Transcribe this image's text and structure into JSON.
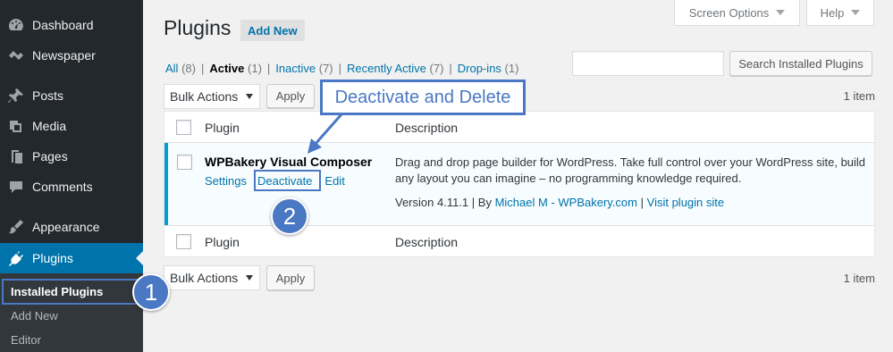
{
  "sidebar": {
    "items": [
      {
        "label": "Dashboard",
        "icon": "dashboard-icon"
      },
      {
        "label": "Newspaper",
        "icon": "newspaper-icon"
      },
      {
        "label": "Posts",
        "icon": "pin-icon"
      },
      {
        "label": "Media",
        "icon": "media-icon"
      },
      {
        "label": "Pages",
        "icon": "pages-icon"
      },
      {
        "label": "Comments",
        "icon": "comments-icon"
      },
      {
        "label": "Appearance",
        "icon": "brush-icon"
      },
      {
        "label": "Plugins",
        "icon": "plug-icon"
      }
    ],
    "submenu": [
      "Installed Plugins",
      "Add New",
      "Editor"
    ]
  },
  "header": {
    "title": "Plugins",
    "add_new": "Add New",
    "screen_options": "Screen Options",
    "help": "Help"
  },
  "filters": {
    "all": "All",
    "all_count": "(8)",
    "active": "Active",
    "active_count": "(1)",
    "inactive": "Inactive",
    "inactive_count": "(7)",
    "recent": "Recently Active",
    "recent_count": "(7)",
    "dropins": "Drop-ins",
    "dropins_count": "(1)",
    "separator": "|"
  },
  "search": {
    "button": "Search Installed Plugins",
    "value": ""
  },
  "bulk": {
    "select": "Bulk Actions",
    "apply": "Apply",
    "count": "1 item"
  },
  "table": {
    "col_plugin": "Plugin",
    "col_description": "Description",
    "plugin": {
      "name": "WPBakery Visual Composer",
      "actions": [
        "Settings",
        "Deactivate",
        "Edit"
      ],
      "description": "Drag and drop page builder for WordPress. Take full control over your WordPress site, build any layout you can imagine – no programming knowledge required.",
      "version": "Version 4.11.1",
      "by": "By",
      "author": "Michael M - WPBakery.com",
      "visit": "Visit plugin site"
    }
  },
  "annotations": {
    "callout": "Deactivate and Delete",
    "step1": "1",
    "step2": "2",
    "color": "#4a78c4"
  },
  "colors": {
    "sidebar": "#23282d",
    "active": "#0073aa",
    "link": "#0073aa"
  }
}
